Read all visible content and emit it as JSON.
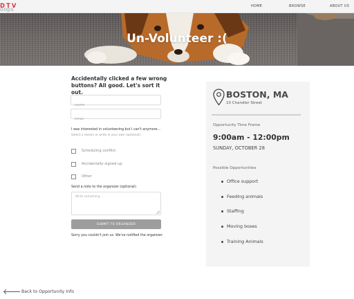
{
  "nav": {
    "logo_text": "DTV",
    "logo_sub": "oops",
    "links": [
      "HOME",
      "BROWSE",
      "ABOUT US"
    ]
  },
  "hero": {
    "title": "Un-Volunteer :("
  },
  "form": {
    "heading": "Accidentally clicked a few wrong buttons? All good. Let's sort it out.",
    "name_placeholder": "Name",
    "email_placeholder": "Email",
    "reason_question": "I was interested in volunteering but I can't anymore...",
    "reason_hint": "Select a reason or write in your own (optional):",
    "options": [
      "Scheduling conflict",
      "Accidentally signed up",
      "Other"
    ],
    "note_label": "Send a note to the organizer (optional):",
    "note_placeholder": "Write something ...",
    "submit_label": "SUBMIT TO ORGANIZER",
    "confirmation": "Sorry you couldn't join us. We've notified the organizer."
  },
  "card": {
    "city": "BOSTON, MA",
    "street": "10 Chandler Street",
    "time_label": "Opportunity Time Frame",
    "time": "9:00am - 12:00pm",
    "date": "SUNDAY, OCTOBER 28",
    "opps_label": "Possible Opportunities",
    "opportunities": [
      "Office support",
      "Feeding animals",
      "Staffing",
      "Moving boxes",
      "Training Animals"
    ]
  },
  "back_link": "Back to Opportunity Info"
}
